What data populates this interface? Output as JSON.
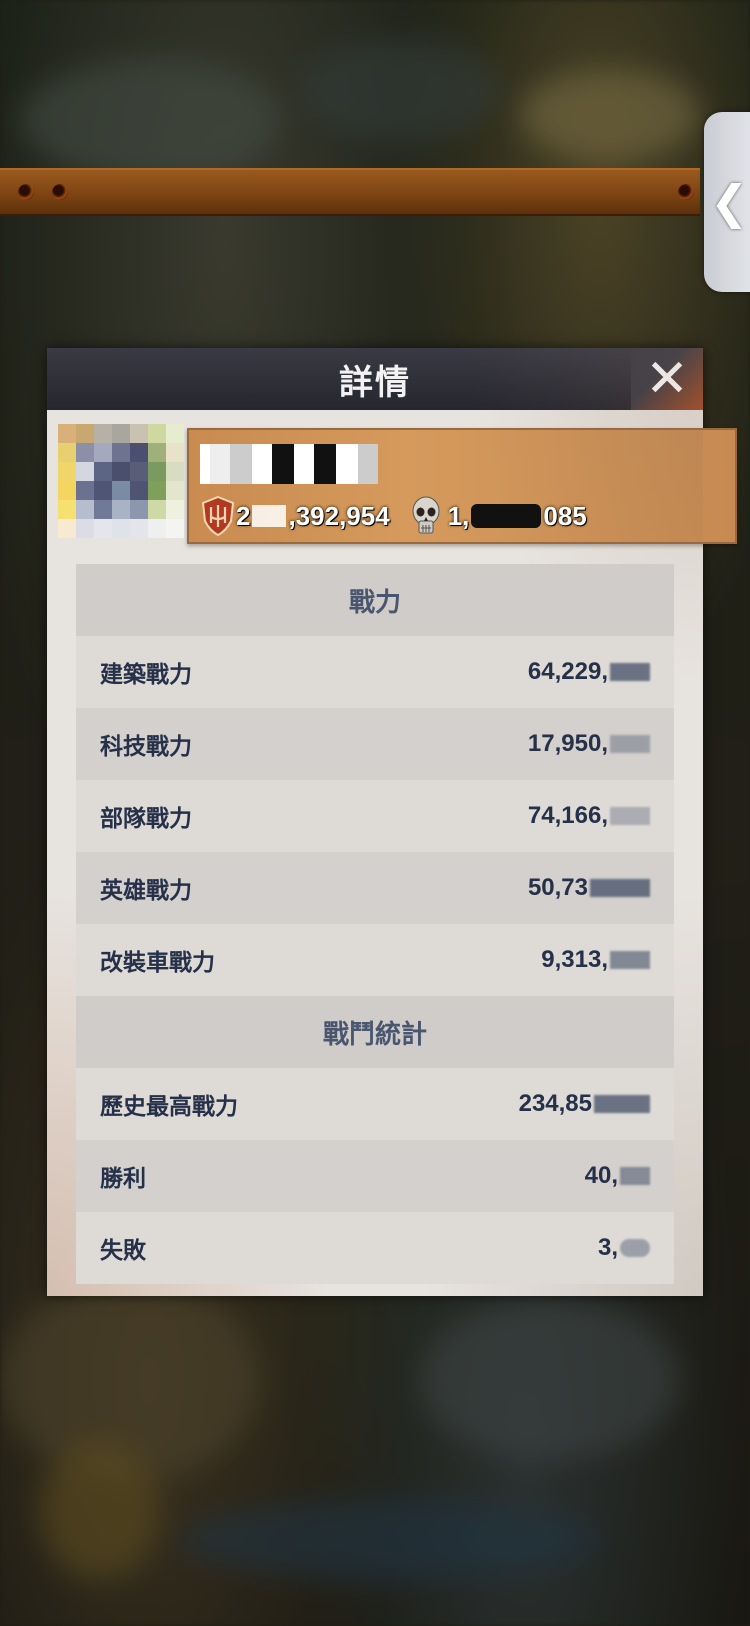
{
  "dialog": {
    "title": "詳情",
    "close_symbol": "✕"
  },
  "side_tab": {
    "arrow": "❮"
  },
  "player": {
    "power_visible": "2",
    "power_suffix": ",392,954",
    "kills_prefix": "1,",
    "kills_suffix": "085",
    "power_icon": "trident-shield-icon",
    "kills_icon": "skull-icon"
  },
  "sections": [
    {
      "header": "戰力",
      "rows": [
        {
          "label": "建築戰力",
          "value": "64,229,"
        },
        {
          "label": "科技戰力",
          "value": "17,950,"
        },
        {
          "label": "部隊戰力",
          "value": "74,166,"
        },
        {
          "label": "英雄戰力",
          "value": "50,73"
        },
        {
          "label": "改裝車戰力",
          "value": "9,313,"
        }
      ]
    },
    {
      "header": "戰鬥統計",
      "rows": [
        {
          "label": "歷史最高戰力",
          "value": "234,85"
        },
        {
          "label": "勝利",
          "value": "40,"
        },
        {
          "label": "失敗",
          "value": "3,"
        }
      ]
    }
  ]
}
